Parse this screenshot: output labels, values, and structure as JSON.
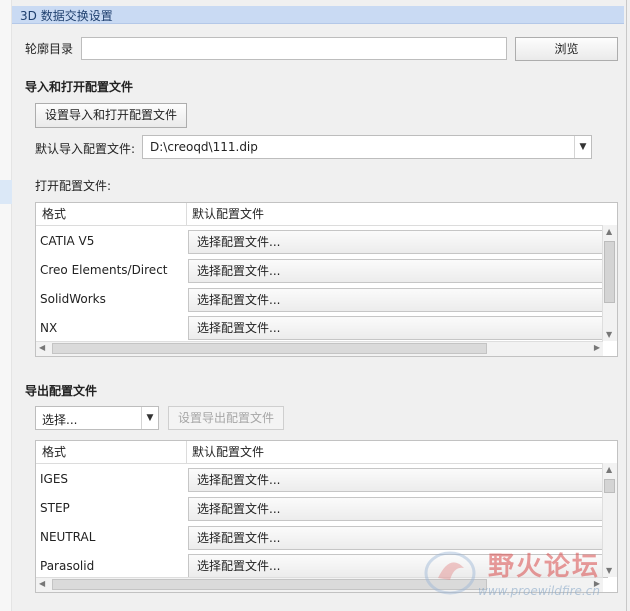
{
  "title": "3D 数据交换设置",
  "profile_dir": {
    "label": "轮廓目录",
    "value": "",
    "browse": "浏览"
  },
  "import_section": {
    "heading": "导入和打开配置文件",
    "set_button": "设置导入和打开配置文件",
    "default_label": "默认导入配置文件:",
    "default_value": "D:\\creoqd\\111.dip",
    "open_label": "打开配置文件:"
  },
  "open_table": {
    "headers": [
      "格式",
      "默认配置文件"
    ],
    "rows": [
      {
        "format": "CATIA V5",
        "config": "选择配置文件..."
      },
      {
        "format": "Creo Elements/Direct",
        "config": "选择配置文件..."
      },
      {
        "format": "SolidWorks",
        "config": "选择配置文件..."
      },
      {
        "format": "NX",
        "config": "选择配置文件..."
      }
    ]
  },
  "export_section": {
    "heading": "导出配置文件",
    "select_value": "选择...",
    "set_button": "设置导出配置文件"
  },
  "export_table": {
    "headers": [
      "格式",
      "默认配置文件"
    ],
    "rows": [
      {
        "format": "IGES",
        "config": "选择配置文件..."
      },
      {
        "format": "STEP",
        "config": "选择配置文件..."
      },
      {
        "format": "NEUTRAL",
        "config": "选择配置文件..."
      },
      {
        "format": "Parasolid",
        "config": "选择配置文件..."
      }
    ]
  },
  "icons": {
    "dropdown": "chevron-down-icon",
    "scroll_up": "triangle-up-icon",
    "scroll_down": "triangle-down-icon",
    "scroll_left": "triangle-left-icon",
    "scroll_right": "triangle-right-icon"
  },
  "watermark": {
    "text": "野火论坛",
    "url": "www.proewildfire.cn"
  },
  "colors": {
    "title_bar": "#c9daf3",
    "watermark": "#d94c4c"
  }
}
